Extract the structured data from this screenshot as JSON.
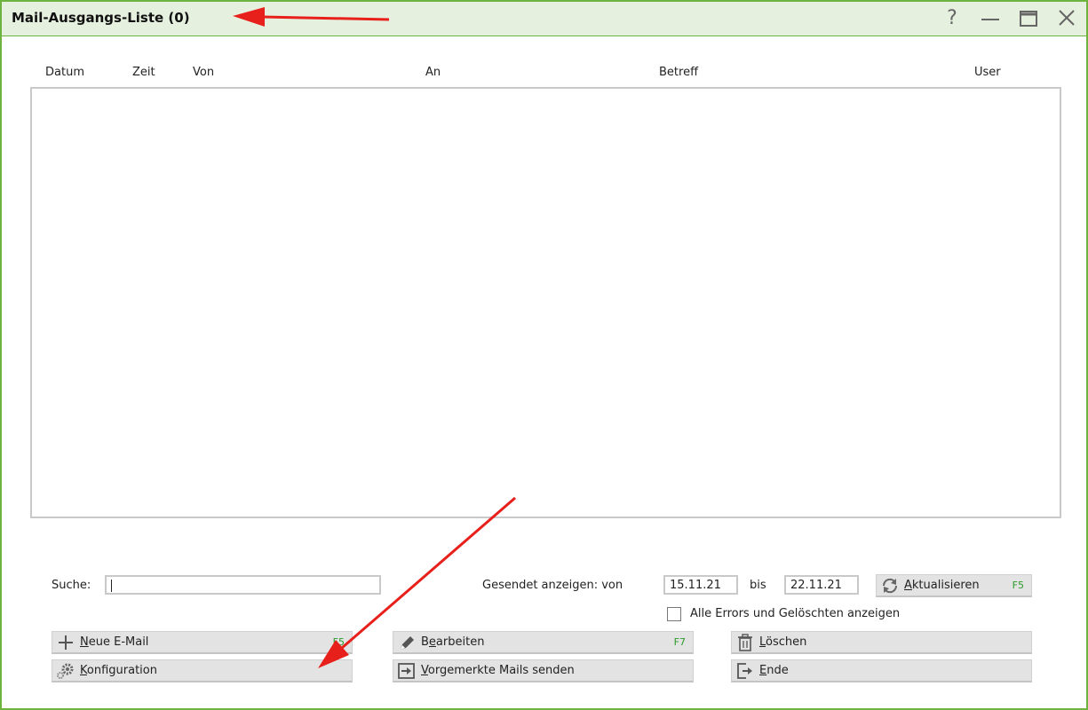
{
  "window": {
    "title": "Mail-Ausgangs-Liste (0)",
    "help_label": "?"
  },
  "table": {
    "columns": [
      "Datum",
      "Zeit",
      "Von",
      "An",
      "Betreff",
      "User"
    ],
    "rows": []
  },
  "search": {
    "label": "Suche:",
    "value": ""
  },
  "filter": {
    "sent_label": "Gesendet anzeigen: von",
    "from_date": "15.11.21",
    "to_label": "bis",
    "to_date": "22.11.21",
    "show_all_label": "Alle Errors und Gelöschten anzeigen",
    "show_all_checked": false
  },
  "buttons": {
    "refresh": {
      "mnemonic": "A",
      "rest": "ktualisieren",
      "fkey": "F5"
    },
    "new_mail": {
      "mnemonic": "N",
      "rest": "eue E-Mail",
      "fkey": "F5"
    },
    "edit": {
      "pre": "B",
      "mnemonic": "e",
      "rest": "arbeiten",
      "fkey": "F7"
    },
    "delete": {
      "mnemonic": "L",
      "rest": "öschen"
    },
    "config": {
      "mnemonic": "K",
      "rest": "onfiguration"
    },
    "send_queued": {
      "mnemonic": "V",
      "rest": "orgemerkte Mails senden"
    },
    "end": {
      "mnemonic": "E",
      "rest": "nde"
    }
  },
  "colors": {
    "accent": "#6cb33f",
    "titlebar_bg": "#e6f0df",
    "annotation_arrow": "#e8201c"
  }
}
